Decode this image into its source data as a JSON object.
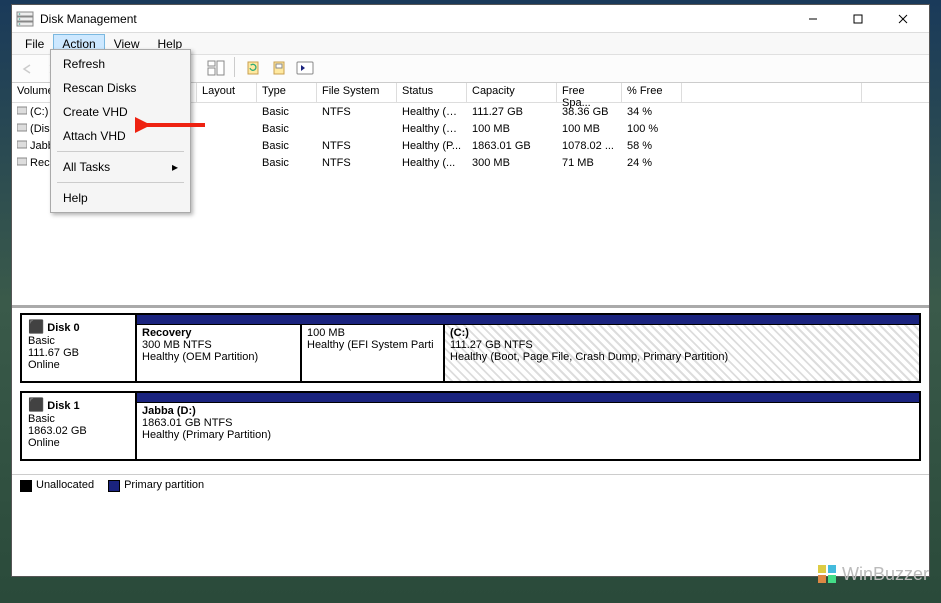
{
  "window": {
    "title": "Disk Management"
  },
  "menubar": {
    "file": "File",
    "action": "Action",
    "view": "View",
    "help": "Help"
  },
  "dropdown": {
    "refresh": "Refresh",
    "rescan": "Rescan Disks",
    "create_vhd": "Create VHD",
    "attach_vhd": "Attach VHD",
    "all_tasks": "All Tasks",
    "help": "Help"
  },
  "columns": {
    "volume": "Volume",
    "layout": "Layout",
    "type": "Type",
    "filesystem": "File System",
    "status": "Status",
    "capacity": "Capacity",
    "freespace": "Free Spa...",
    "pctfree": "% Free"
  },
  "widths": {
    "volume": 185,
    "layout": 60,
    "type": 60,
    "fs": 80,
    "status": 70,
    "capacity": 90,
    "free": 65,
    "pct": 60
  },
  "rows": [
    {
      "volume": "(C:)",
      "type": "Basic",
      "fs": "NTFS",
      "status": "Healthy (B...",
      "capacity": "111.27 GB",
      "free": "38.36 GB",
      "pct": "34 %"
    },
    {
      "volume": "(Disk 0 partition 2)",
      "type": "Basic",
      "fs": "",
      "status": "Healthy (E...",
      "capacity": "100 MB",
      "free": "100 MB",
      "pct": "100 %"
    },
    {
      "volume": "Jabba (D:)",
      "type": "Basic",
      "fs": "NTFS",
      "status": "Healthy (P...",
      "capacity": "1863.01 GB",
      "free": "1078.02 ...",
      "pct": "58 %"
    },
    {
      "volume": "Recovery",
      "type": "Basic",
      "fs": "NTFS",
      "status": "Healthy (...",
      "capacity": "300 MB",
      "free": "71 MB",
      "pct": "24 %"
    }
  ],
  "disks": [
    {
      "name": "Disk 0",
      "type": "Basic",
      "size": "111.67 GB",
      "state": "Online",
      "parts": [
        {
          "title": "Recovery",
          "line2": "300 MB NTFS",
          "line3": "Healthy (OEM Partition)",
          "w": 165,
          "hatch": false
        },
        {
          "title": "",
          "line2": "100 MB",
          "line3": "Healthy (EFI System Parti",
          "w": 143,
          "hatch": false
        },
        {
          "title": "(C:)",
          "line2": "111.27 GB NTFS",
          "line3": "Healthy (Boot, Page File, Crash Dump, Primary Partition)",
          "w": 0,
          "hatch": true
        }
      ]
    },
    {
      "name": "Disk 1",
      "type": "Basic",
      "size": "1863.02 GB",
      "state": "Online",
      "parts": [
        {
          "title": "Jabba  (D:)",
          "line2": "1863.01 GB NTFS",
          "line3": "Healthy (Primary Partition)",
          "w": 0,
          "hatch": false
        }
      ]
    }
  ],
  "legend": {
    "unalloc": "Unallocated",
    "primary": "Primary partition"
  },
  "watermark": {
    "text": "WinBuzzer"
  }
}
